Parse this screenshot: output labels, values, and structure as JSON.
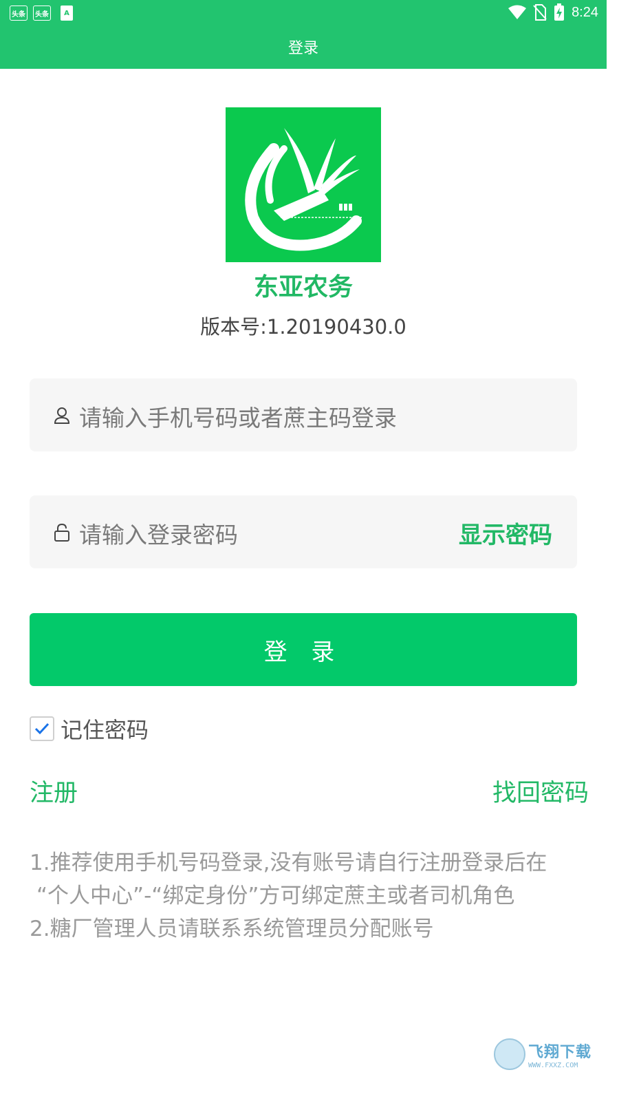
{
  "status_bar": {
    "notifications": [
      "头条",
      "头条",
      "A"
    ],
    "time": "8:24"
  },
  "header": {
    "title": "登录"
  },
  "app": {
    "name": "东亚农务",
    "version": "版本号:1.20190430.0"
  },
  "form": {
    "username_placeholder": "请输入手机号码或者蔗主码登录",
    "password_placeholder": "请输入登录密码",
    "show_password": "显示密码",
    "login_button": "登 录",
    "remember_label": "记住密码",
    "remember_checked": true
  },
  "links": {
    "register": "注册",
    "forgot": "找回密码"
  },
  "notes": [
    "1.推荐使用手机号码登录,没有账号请自行注册登录后在",
    "“个人中心”-“绑定身份”方可绑定蔗主或者司机角色",
    "2.糖厂管理人员请联系系统管理员分配账号"
  ],
  "watermark": {
    "main": "飞翔下载",
    "sub": "WWW.FXXZ.COM"
  },
  "colors": {
    "brand_green": "#22c46f",
    "button_green": "#03c96a",
    "link_green": "#22b866"
  }
}
